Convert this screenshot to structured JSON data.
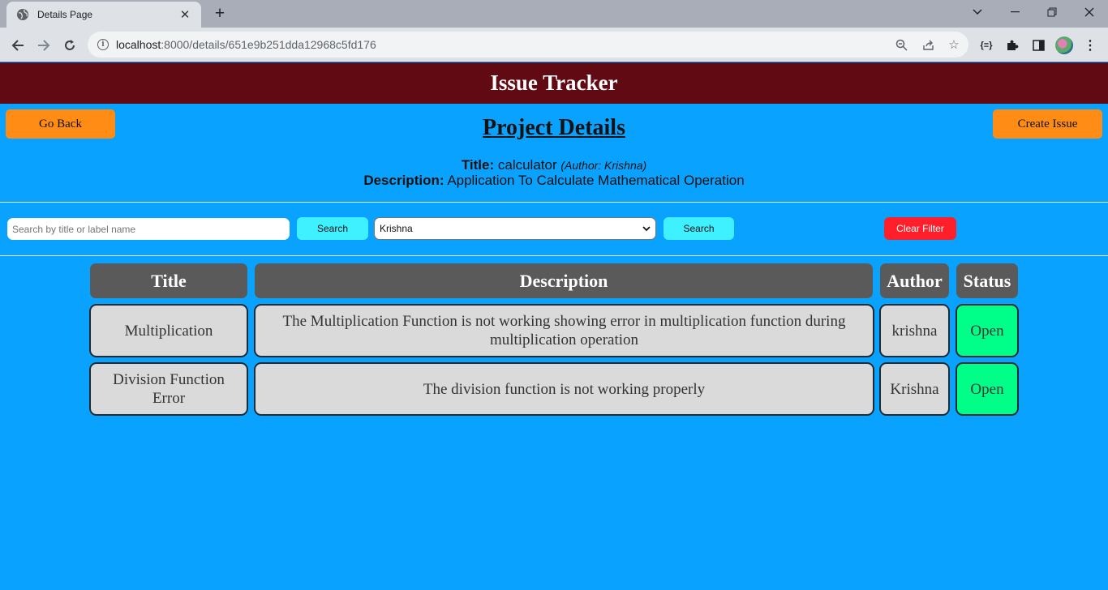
{
  "browser": {
    "tab_title": "Details Page",
    "url_host": "localhost",
    "url_rest": ":8000/details/651e9b251dda12968c5fd176"
  },
  "app": {
    "header_title": "Issue Tracker",
    "go_back_label": "Go Back",
    "create_issue_label": "Create Issue",
    "page_title": "Project Details"
  },
  "project": {
    "title_label": "Title:",
    "title_value": "calculator",
    "author_note": "(Author: Krishna)",
    "description_label": "Description:",
    "description_value": "Application To Calculate Mathematical Operation"
  },
  "filters": {
    "search_placeholder": "Search by title or label name",
    "search_button": "Search",
    "author_select_value": "Krishna",
    "author_search_button": "Search",
    "clear_filter_button": "Clear Filter"
  },
  "table": {
    "headers": [
      "Title",
      "Description",
      "Author",
      "Status"
    ],
    "rows": [
      {
        "title": "Multiplication",
        "description": "The Multiplication Function is not working showing error in multiplication function during multiplication operation",
        "author": "krishna",
        "status": "Open"
      },
      {
        "title": "Division Function Error",
        "description": "The division function is not working properly",
        "author": "Krishna",
        "status": "Open"
      }
    ]
  },
  "colors": {
    "page_bg": "#09a3ff",
    "header_bg": "#620a14",
    "orange_button": "#ff8c14",
    "cyan_button": "#3ff0ff",
    "red_button": "#ff1f2a",
    "status_open": "#00ff88"
  }
}
